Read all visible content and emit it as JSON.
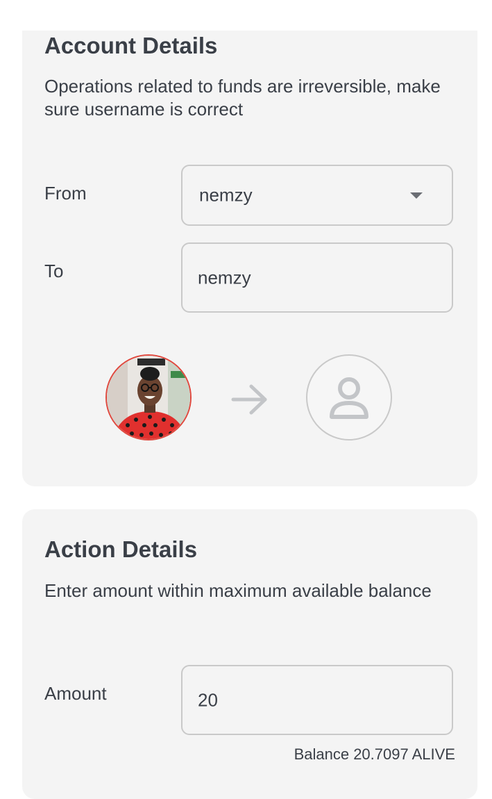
{
  "account_details": {
    "title": "Account Details",
    "subtitle": "Operations related to funds are irreversible, make sure username is correct",
    "from": {
      "label": "From",
      "value": "nemzy"
    },
    "to": {
      "label": "To",
      "value": "nemzy"
    }
  },
  "action_details": {
    "title": "Action Details",
    "subtitle": "Enter amount within maximum available balance",
    "amount": {
      "label": "Amount",
      "value": "20"
    },
    "balance": "Balance 20.7097 ALIVE"
  },
  "colors": {
    "card_bg": "#f4f4f4",
    "text": "#3a3f47",
    "border": "#c9c9c9",
    "avatar_shirt": "#e0302e"
  },
  "icons": {
    "arrow": "arrow-right-icon",
    "placeholder_avatar": "user-icon",
    "dropdown": "chevron-down-icon"
  }
}
